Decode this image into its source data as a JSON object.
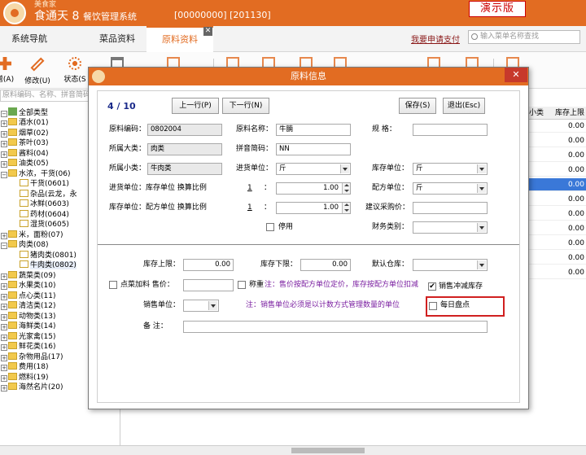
{
  "window": {
    "app_small": "美食家",
    "app_name": "食通天 8",
    "app_sub": "餐饮管理系统",
    "codes": "[00000000]  [201130]",
    "demo_badge": "演示版"
  },
  "tabs": [
    {
      "label": "系统导航"
    },
    {
      "label": "菜品资料"
    },
    {
      "label": "原料资料",
      "active": true
    }
  ],
  "header": {
    "help_link": "我要申请支付",
    "search_placeholder": "输入菜单名称查找"
  },
  "toolbar": {
    "add_label": "增(A)",
    "edit_label": "修改(U)",
    "status_label": "状态(S"
  },
  "tree": {
    "search_placeholder": "原料编码、名称、拼音简码",
    "root": "全部类型",
    "items": [
      "酒水(01)",
      "烟草(02)",
      "茶叶(03)",
      "酱料(04)",
      "油类(05)",
      "水浓，干货(06)",
      "干货(0601)",
      "杂品(云龙，永",
      "冰鲜(0603)",
      "药材(0604)",
      "湿货(0605)",
      "米，面粉(07)",
      "肉类(08)",
      "猪肉类(0801)",
      "牛肉类(0802)",
      "蔬菜类(09)",
      "水果类(10)",
      "点心类(11)",
      "清洁类(12)",
      "动物类(13)",
      "海鲜类(14)",
      "光家禽(15)",
      "鲜花类(16)",
      "杂物用品(17)",
      "费用(18)",
      "燃料(19)",
      "海然名片(20)"
    ]
  },
  "grid": {
    "headers": [
      "小类",
      "库存上限"
    ],
    "values": [
      "0.00",
      "0.00",
      "0.00",
      "0.00",
      "0.00",
      "0.00",
      "0.00",
      "0.00",
      "0.00",
      "0.00",
      "0.00"
    ],
    "selected_index": 4
  },
  "dialog": {
    "title": "原料信息",
    "record_pos": "4 / 10",
    "prev_btn": "上一行(P)",
    "next_btn": "下一行(N)",
    "save_btn": "保存(S)",
    "exit_btn": "退出(Esc)",
    "labels": {
      "code": "原料编码：",
      "name": "原料名称：",
      "spec": "规      格：",
      "big_cat": "所属大类：",
      "pinyin": "拼音简码：",
      "small_cat": "所属小类：",
      "in_unit": "进货单位：",
      "stock_unit": "库存单位：",
      "in_ratio": "进货单位：库存单位 换算比例",
      "dist_unit": "配方单位：",
      "stock_ratio": "库存单位：配方单位 换算比例",
      "suggest_price": "建议采购价：",
      "finance_cat": "财务类别：",
      "disabled": "停用",
      "stock_max": "库存上限：",
      "stock_min": "库存下限：",
      "default_wh": "默认仓库：",
      "add_dish": "点菜加料 售价：",
      "weigh": "称重",
      "sale_deduct": "销售冲减库存",
      "sale_unit": "销售单位：",
      "daily_check": "每日盘点",
      "remark": "备      注："
    },
    "values": {
      "code": "0802004",
      "name": "牛腩",
      "spec": "",
      "big_cat": "肉类",
      "pinyin": "NN",
      "small_cat": "牛肉类",
      "in_unit": "斤",
      "stock_unit": "斤",
      "in_ratio_left": "1",
      "in_ratio_right": "1.00",
      "dist_unit": "斤",
      "stock_ratio_left": "1",
      "stock_ratio_right": "1.00",
      "suggest_price": "",
      "finance_cat": "",
      "stock_max": "0.00",
      "stock_min": "0.00",
      "default_wh": "",
      "sale_price": "",
      "sale_unit": "",
      "remark": ""
    },
    "checks": {
      "disabled": false,
      "add_dish": false,
      "weigh": false,
      "sale_deduct": true,
      "daily_check": false
    },
    "notes": {
      "weigh_note": "注：售价按配方单位定价，库存按配方单位扣减",
      "sale_unit_note": "注：销售单位必须是以计数方式管理数量的单位"
    },
    "colon": "："
  },
  "colors": {
    "accent": "#e26c22",
    "highlight": "#d02020",
    "note": "#7a1ea0",
    "selected_row": "#3a78d8"
  }
}
